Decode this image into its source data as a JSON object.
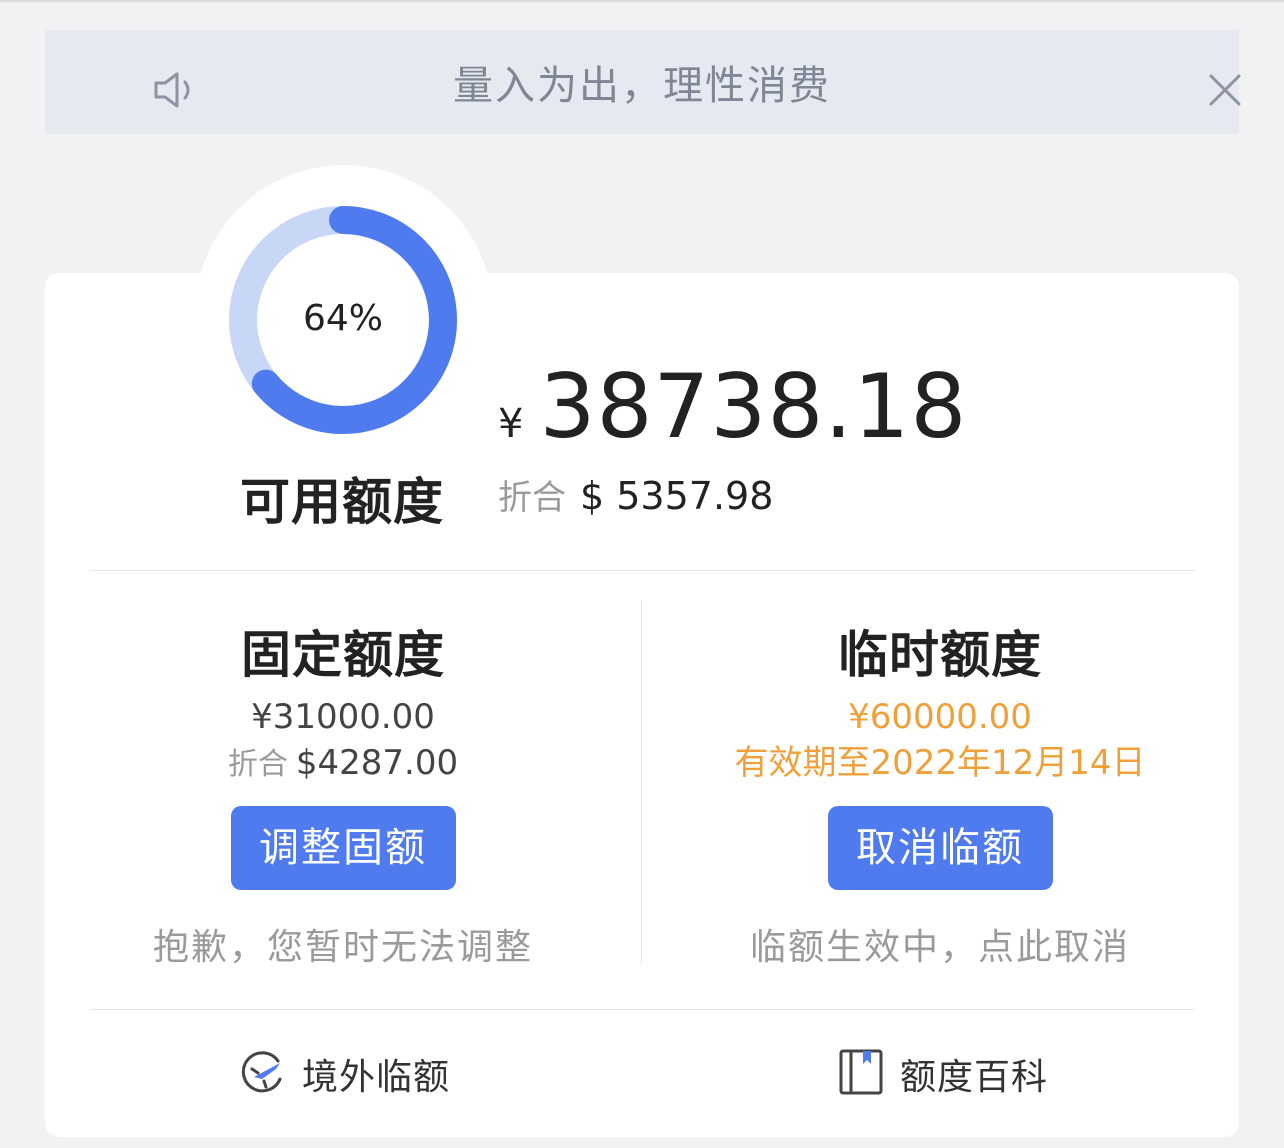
{
  "notice": {
    "text": "量入为出，理性消费",
    "speaker_icon": "speaker-icon",
    "close_icon": "close-icon"
  },
  "available": {
    "percent_label": "64%",
    "percent_value": 0.64,
    "label": "可用额度",
    "currency_symbol": "¥",
    "amount": "38738.18",
    "converted_label": "折合",
    "converted_value": "$ 5357.98"
  },
  "fixed": {
    "title": "固定额度",
    "amount": "¥31000.00",
    "converted_label": "折合",
    "converted_value": "$4287.00",
    "button_label": "调整固额",
    "hint": "抱歉，您暂时无法调整"
  },
  "temporary": {
    "title": "临时额度",
    "amount": "¥60000.00",
    "validity": "有效期至2022年12月14日",
    "button_label": "取消临额",
    "hint": "临额生效中，点此取消"
  },
  "links": {
    "overseas": {
      "label": "境外临额",
      "icon": "plane-globe-icon"
    },
    "wiki": {
      "label": "额度百科",
      "icon": "book-icon"
    }
  },
  "colors": {
    "accent": "#4f7bef",
    "gauge_track": "#c9d7f7",
    "warning": "#f0a03a"
  }
}
